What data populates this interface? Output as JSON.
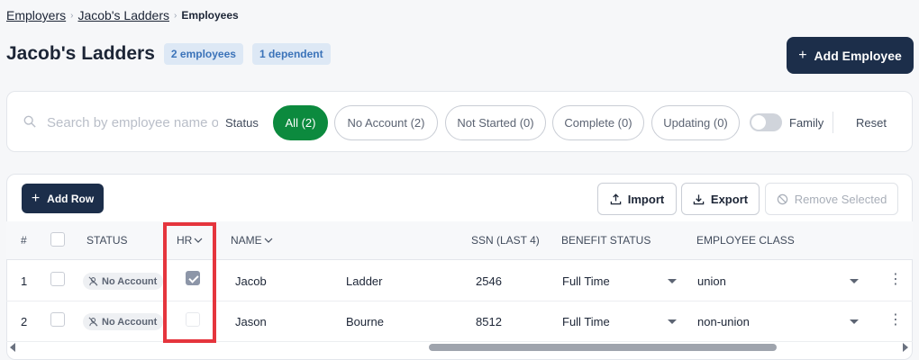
{
  "breadcrumb": {
    "items": [
      "Employers",
      "Jacob's Ladders"
    ],
    "current": "Employees"
  },
  "header": {
    "title": "Jacob's Ladders",
    "employee_count": "2 employees",
    "dependent_count": "1 dependent",
    "add_employee": "Add Employee"
  },
  "filters": {
    "search_placeholder": "Search by employee name or SSN",
    "status_label": "Status",
    "chips": [
      "All (2)",
      "No Account (2)",
      "Not Started (0)",
      "Complete (0)",
      "Updating (0)"
    ],
    "active_chip": "All (2)",
    "family_label": "Family",
    "family_toggle": false,
    "reset": "Reset"
  },
  "toolbar": {
    "add_row": "Add Row",
    "import": "Import",
    "export": "Export",
    "remove_selected": "Remove Selected"
  },
  "table": {
    "headers": {
      "index": "#",
      "status": "STATUS",
      "hr": "HR",
      "name": "NAME",
      "ssn": "SSN (LAST 4)",
      "benefit_status": "BENEFIT STATUS",
      "employee_class": "EMPLOYEE CLASS"
    },
    "rows": [
      {
        "index": "1",
        "status": "No Account",
        "hr": true,
        "first_name": "Jacob",
        "last_name": "Ladder",
        "ssn": "2546",
        "benefit_status": "Full Time",
        "employee_class": "union"
      },
      {
        "index": "2",
        "status": "No Account",
        "hr": false,
        "first_name": "Jason",
        "last_name": "Bourne",
        "ssn": "8512",
        "benefit_status": "Full Time",
        "employee_class": "non-union"
      }
    ]
  },
  "colors": {
    "primary": "#1c2e4a",
    "active_chip": "#0c8a3e",
    "pill_bg": "#dde8f5",
    "pill_text": "#3b73b9",
    "highlight": "#e5353d"
  }
}
